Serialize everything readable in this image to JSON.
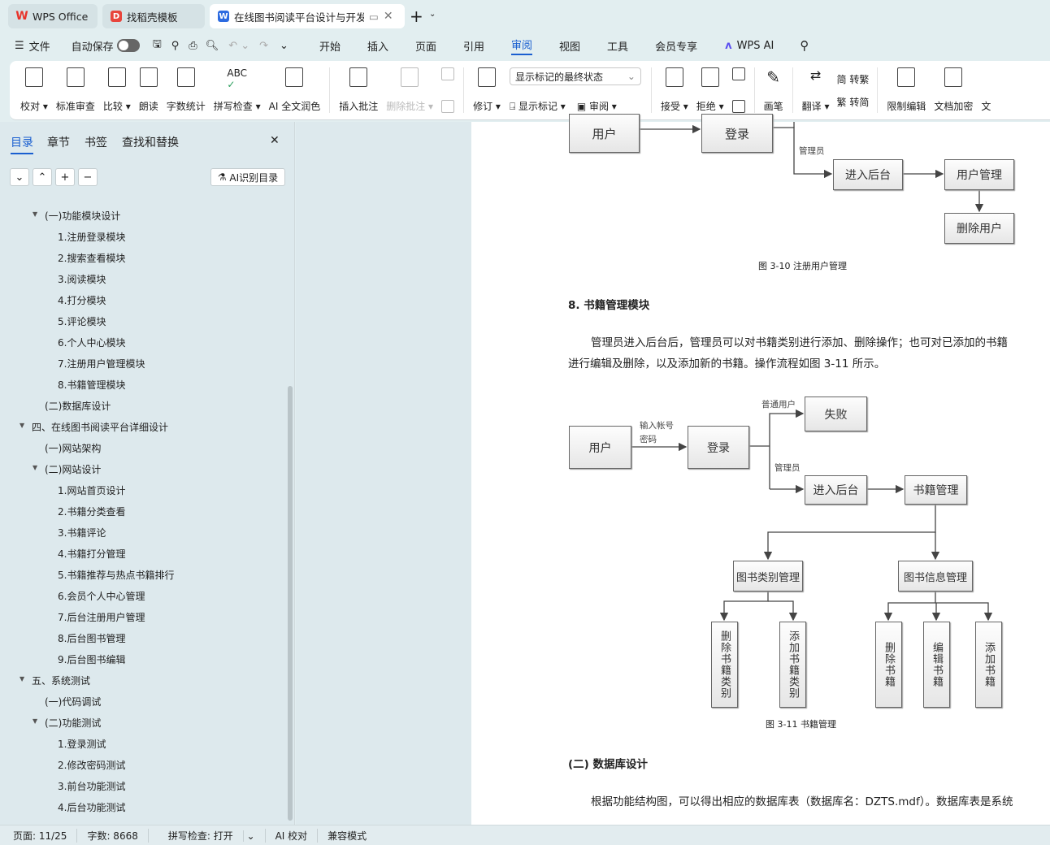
{
  "tabs": [
    {
      "label": "WPS Office",
      "icon": "wps-logo-icon"
    },
    {
      "label": "找稻壳模板",
      "icon": "docer-icon"
    },
    {
      "label": "在线图书阅读平台设计与开发",
      "icon": "word-doc-icon"
    }
  ],
  "menu": {
    "file": "文件",
    "autosave": "自动保存",
    "autosave_on": false,
    "items": [
      "开始",
      "插入",
      "页面",
      "引用",
      "审阅",
      "视图",
      "工具",
      "会员专享"
    ],
    "active": "审阅",
    "wps_ai": "WPS AI"
  },
  "ribbon": {
    "g1": [
      "校对",
      "标准审查",
      "比较",
      "朗读",
      "字数统计",
      "拼写检查",
      "AI 全文润色"
    ],
    "insert_comment": "插入批注",
    "delete_comment": "删除批注",
    "revise": "修订",
    "markup_select": "显示标记的最终状态",
    "show_markup": "显示标记",
    "review": "审阅",
    "accept": "接受",
    "reject": "拒绝",
    "pen": "画笔",
    "translate": "翻译",
    "to_trad": "转繁",
    "to_simp": "转简",
    "restrict": "限制编辑",
    "encrypt": "文档加密",
    "more": "文"
  },
  "sidebar": {
    "tabs": [
      "目录",
      "章节",
      "书签",
      "查找和替换"
    ],
    "active": "目录",
    "ai_toc": "AI识别目录",
    "toc": [
      {
        "t": "(一)功能模块设计",
        "l": 2,
        "e": true
      },
      {
        "t": "1.注册登录模块",
        "l": 3
      },
      {
        "t": "2.搜索查看模块",
        "l": 3
      },
      {
        "t": "3.阅读模块",
        "l": 3
      },
      {
        "t": "4.打分模块",
        "l": 3
      },
      {
        "t": "5.评论模块",
        "l": 3
      },
      {
        "t": "6.个人中心模块",
        "l": 3
      },
      {
        "t": "7.注册用户管理模块",
        "l": 3
      },
      {
        "t": "8.书籍管理模块",
        "l": 3
      },
      {
        "t": "(二)数据库设计",
        "l": 2
      },
      {
        "t": "四、在线图书阅读平台详细设计",
        "l": 1,
        "e": true
      },
      {
        "t": "(一)网站架构",
        "l": 2
      },
      {
        "t": "(二)网站设计",
        "l": 2,
        "e": true
      },
      {
        "t": "1.网站首页设计",
        "l": 3
      },
      {
        "t": "2.书籍分类查看",
        "l": 3
      },
      {
        "t": "3.书籍评论",
        "l": 3
      },
      {
        "t": "4.书籍打分管理",
        "l": 3
      },
      {
        "t": "5.书籍推荐与热点书籍排行",
        "l": 3
      },
      {
        "t": "6.会员个人中心管理",
        "l": 3
      },
      {
        "t": "7.后台注册用户管理",
        "l": 3
      },
      {
        "t": "8.后台图书管理",
        "l": 3
      },
      {
        "t": "9.后台图书编辑",
        "l": 3
      },
      {
        "t": "五、系统测试",
        "l": 1,
        "e": true
      },
      {
        "t": "(一)代码调试",
        "l": 2
      },
      {
        "t": "(二)功能测试",
        "l": 2,
        "e": true
      },
      {
        "t": "1.登录测试",
        "l": 3
      },
      {
        "t": "2.修改密码测试",
        "l": 3
      },
      {
        "t": "3.前台功能测试",
        "l": 3
      },
      {
        "t": "4.后台功能测试",
        "l": 3
      }
    ]
  },
  "doc": {
    "d1": {
      "user": "用户",
      "login": "登录",
      "admin": "管理员",
      "backend": "进入后台",
      "user_mgmt": "用户管理",
      "delete_user": "删除用户",
      "caption": "图 3-10 注册用户管理"
    },
    "heading8": "8.    书籍管理模块",
    "para1": "管理员进入后台后，管理员可以对书籍类别进行添加、删除操作；也可对已添加的书籍",
    "para2": "进行编辑及删除，以及添加新的书籍。操作流程如图 3-11 所示。",
    "d2": {
      "user": "用户",
      "input1": "输入帐号",
      "input2": "密码",
      "login": "登录",
      "normal": "普通用户",
      "fail": "失败",
      "admin": "管理员",
      "backend": "进入后台",
      "book_mgmt": "书籍管理",
      "cat_mgmt": "图书类别管理",
      "info_mgmt": "图书信息管理",
      "del_cat": "删除书籍类别",
      "add_cat": "添加书籍类别",
      "del_book": "删除书籍",
      "edit_book": "编辑书籍",
      "add_book": "添加书籍",
      "caption": "图 3-11  书籍管理"
    },
    "heading_db": "(二) 数据库设计",
    "para3": "根据功能结构图，可以得出相应的数据库表（数据库名：DZTS.mdf）。数据库表是系统"
  },
  "status": {
    "page": "页面: 11/25",
    "words": "字数: 8668",
    "spell": "拼写检查: 打开",
    "ai": "AI 校对",
    "compat": "兼容模式"
  },
  "colors": {
    "accent": "#1a5fd0",
    "wps_red": "#e8332a"
  }
}
